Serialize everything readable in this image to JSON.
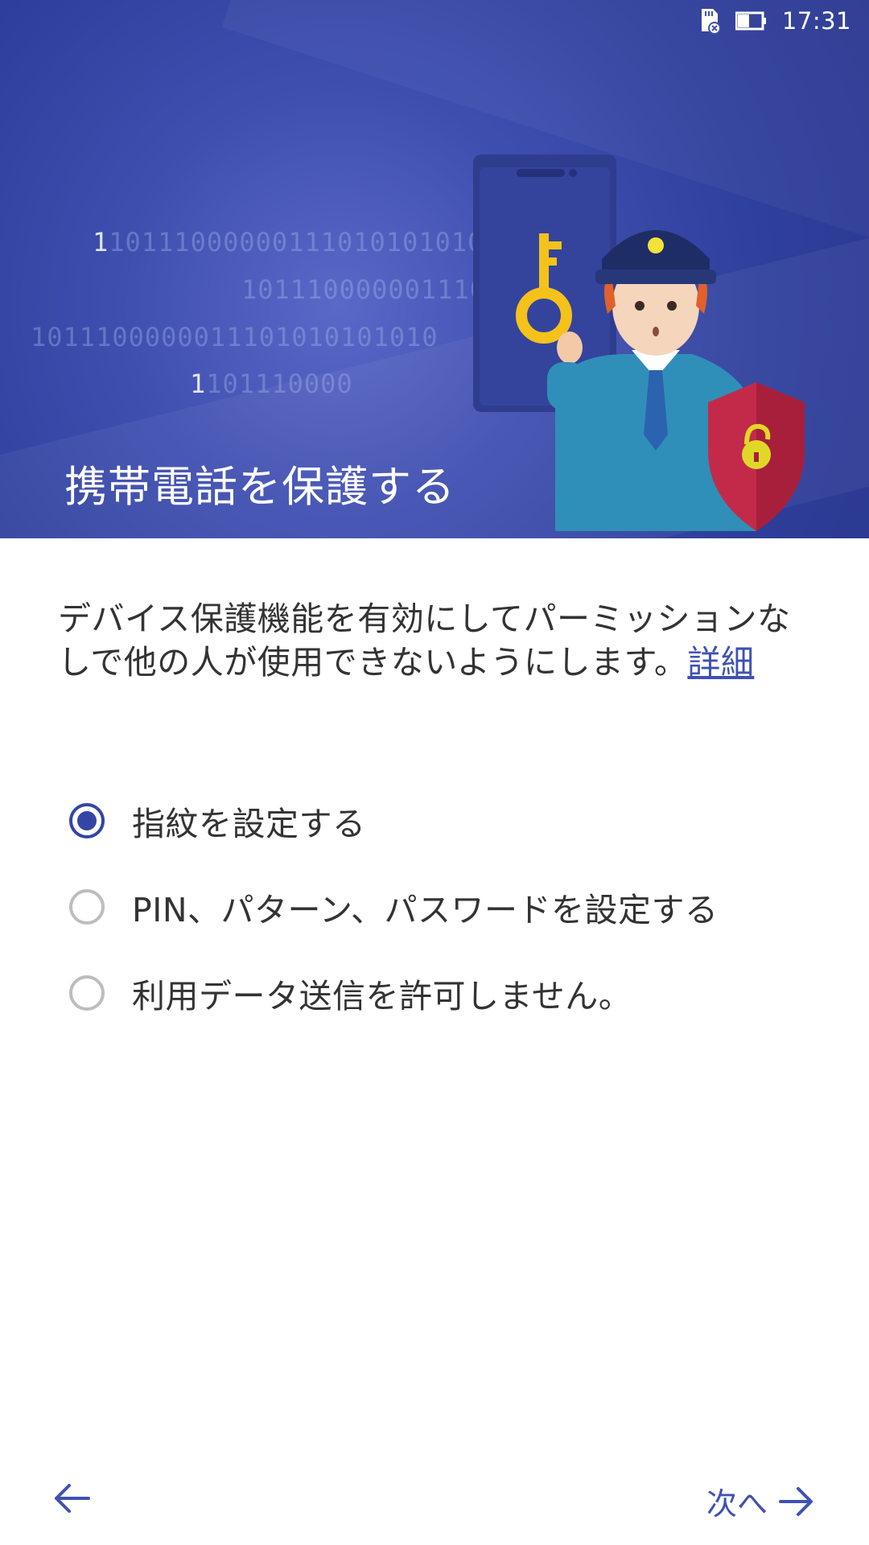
{
  "status_bar": {
    "time": "17:31",
    "icons": [
      "sd-card-icon",
      "battery-icon"
    ]
  },
  "hero": {
    "title": "携帯電話を保護する",
    "binary_lines": [
      "1011100000011101010101010",
      "10111000000111010101010",
      "1011100000011101010101010",
      "101110000"
    ],
    "illustration": "security-officer-with-key-phone-shield"
  },
  "description": {
    "text": "デバイス保護機能を有効にしてパーミッションなしで他の人が使用できないようにします。",
    "link_label": "詳細"
  },
  "options": [
    {
      "label": "指紋を設定する",
      "selected": true
    },
    {
      "label": "PIN、パターン、パスワードを設定する",
      "selected": false
    },
    {
      "label": "利用データ送信を許可しません。",
      "selected": false
    }
  ],
  "navigation": {
    "back_icon": "arrow-left-icon",
    "next_label": "次へ",
    "next_icon": "arrow-right-icon"
  },
  "colors": {
    "accent": "#3f51b5",
    "hero_bg": "#3f4fb0",
    "text": "#333333"
  }
}
